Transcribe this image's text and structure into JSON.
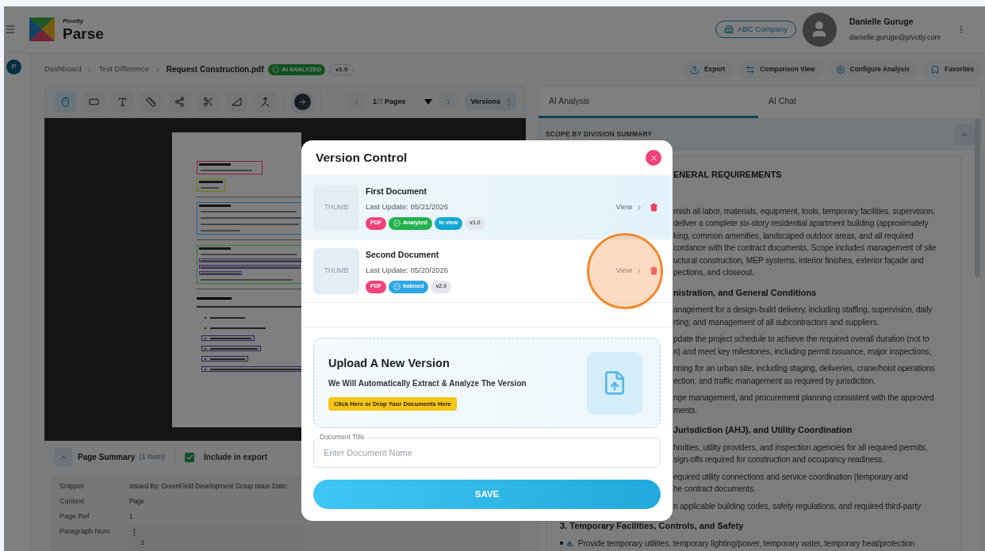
{
  "app": {
    "brand_small": "Pivotly",
    "brand": "Parse"
  },
  "header": {
    "company": "ABC Company",
    "user_name": "Danielle Guruge",
    "user_email": "danielle.guruge@pivotly.com"
  },
  "rail": {
    "avatar_letter": "P"
  },
  "breadcrumb": {
    "items": [
      "Dashboard",
      "Test Difference"
    ],
    "current": "Request Construction.pdf",
    "status": "AI ANALYZED",
    "version": "v1.0"
  },
  "actions": [
    {
      "kind": "export",
      "label": "Export"
    },
    {
      "kind": "compare",
      "label": "Comparison View"
    },
    {
      "kind": "configure",
      "label": "Configure Analysis"
    },
    {
      "kind": "favorite",
      "label": "Favorites"
    }
  ],
  "toolbar": {
    "tools": [
      {
        "kind": "pointer",
        "selected": true
      },
      {
        "kind": "rectangle",
        "selected": false
      },
      {
        "kind": "text",
        "selected": false
      },
      {
        "kind": "ruler",
        "selected": false
      },
      {
        "kind": "connector",
        "selected": false
      },
      {
        "kind": "scissors",
        "selected": false
      },
      {
        "kind": "angle",
        "selected": false
      },
      {
        "kind": "merge",
        "selected": false
      }
    ],
    "pager": {
      "current": "1",
      "total": "/3",
      "label": "Pages"
    },
    "versions": "Versions"
  },
  "document_page": {
    "blocks": [
      {
        "kind": "box",
        "color": "#8b1a4b",
        "lines": [
          {
            "highlighted": false
          }
        ]
      },
      {
        "kind": "box",
        "color": "#77760f",
        "lines": [
          {
            "highlighted": false
          }
        ]
      },
      {
        "kind": "rule"
      },
      {
        "kind": "box",
        "color": "#1f5f99",
        "lines": [
          {
            "highlighted": false
          },
          {
            "highlighted": false
          },
          {
            "highlighted": false
          },
          {
            "highlighted": false
          }
        ]
      },
      {
        "kind": "rule"
      },
      {
        "kind": "box",
        "color": "#2f7a33",
        "lines": [
          {
            "highlighted": false
          },
          {
            "highlighted": true
          },
          {
            "highlighted": true
          },
          {
            "highlighted": true
          },
          {
            "highlighted": false
          }
        ]
      },
      {
        "kind": "rule"
      },
      {
        "kind": "heading"
      },
      {
        "kind": "text"
      },
      {
        "kind": "bullet",
        "highlighted": false
      },
      {
        "kind": "bullet",
        "highlighted": false
      },
      {
        "kind": "bullet",
        "highlighted": true
      },
      {
        "kind": "bullet",
        "highlighted": true
      },
      {
        "kind": "bullet",
        "highlighted": true
      },
      {
        "kind": "bullet",
        "highlighted": true
      }
    ]
  },
  "page_summary": {
    "title": "Page Summary",
    "count": "(1 Item)",
    "include_label": "Include in export",
    "include_checked": true,
    "rows": [
      {
        "label": "Snippet",
        "value": "Issued By: GreenField Development Group Issue Date:"
      },
      {
        "label": "Context",
        "value": "Page"
      },
      {
        "label": "Page Ref",
        "value": "1"
      },
      {
        "label": "Paragraph Num",
        "code": [
          "[",
          "1"
        ]
      }
    ]
  },
  "right_panel": {
    "tabs": [
      {
        "label": "AI Analysis",
        "selected": true
      },
      {
        "label": "AI Chat",
        "selected": false
      }
    ],
    "section_title": "SCOPE BY DIVISION SUMMARY",
    "blocks": [
      {
        "kind": "heading",
        "clipped": true,
        "text": "ENERAL REQUIREMENTS"
      },
      {
        "kind": "paragraph",
        "clipped": true,
        "lines": [
          "rnish all labor, materials, equipment, tools, temporary facilities, supervision,",
          "deliver a complete six-story residential apartment building (approximately",
          "king, common amenities, landscaped outdoor areas, and all required",
          "cordance with the contract documents. Scope includes management of site",
          "uctural construction, MEP systems, interior finishes, exterior façade and",
          "pections, and closeout."
        ]
      },
      {
        "kind": "heading",
        "clipped": true,
        "text": "nistration, and General Conditions"
      },
      {
        "kind": "paragraph",
        "clipped": true,
        "lines": [
          "anagement for a design-build delivery, including staffing, supervision, daily",
          "rting, and management of all subcontractors and suppliers."
        ]
      },
      {
        "kind": "paragraph",
        "clipped": true,
        "lines": [
          "pdate the project schedule to achieve the required overall duration (not to",
          "n) and meet key milestones, including permit issuance, major inspections,"
        ]
      },
      {
        "kind": "paragraph",
        "clipped": true,
        "lines": [
          "nning for an urban site, including staging, deliveries, crane/hoist operations",
          "ection, and traffic management as required by jurisdiction."
        ]
      },
      {
        "kind": "paragraph",
        "clipped": true,
        "lines": [
          "nge management, and procurement planning consistent with the approved",
          "ments."
        ]
      },
      {
        "kind": "heading",
        "clipped": true,
        "text": "Jurisdiction (AHJ), and Utility Coordination"
      },
      {
        "kind": "paragraph",
        "clipped": true,
        "lines": [
          "horities, utility providers, and inspection agencies for all required permits,",
          "sign-offs required for construction and occupancy readiness."
        ]
      },
      {
        "kind": "paragraph",
        "clipped": true,
        "lines": [
          "equired utility connections and service coordination (temporary and",
          "he contract documents."
        ]
      },
      {
        "kind": "paragraph",
        "clipped": true,
        "lines": [
          "n applicable building codes, safety regulations, and required third-party"
        ]
      },
      {
        "kind": "heading",
        "clipped": false,
        "text": "3. Temporary Facilities, Controls, and Safety"
      },
      {
        "kind": "item",
        "clipped": false,
        "marker": "a.",
        "text": "Provide temporary utilities, temporary lighting/power, temporary water, temporary heat/protection"
      }
    ]
  },
  "modal": {
    "title": "Version Control",
    "documents": [
      {
        "thumb": "THUMB",
        "name": "First Document",
        "updated": "Last Update: 05/21/2026",
        "selected": true,
        "view": "View",
        "tags": [
          {
            "kind": "plain",
            "text": "PDF",
            "color": "#f0437a"
          },
          {
            "kind": "status",
            "text": "Analyzed",
            "color": "#22b14c"
          },
          {
            "kind": "plain",
            "text": "In view",
            "color": "#14a8d4"
          },
          {
            "kind": "plain",
            "text": "v1.0",
            "color": "#e4e7ee"
          }
        ]
      },
      {
        "thumb": "THUMB",
        "name": "Second Document",
        "updated": "Last Update: 05/20/2026",
        "selected": false,
        "view": "View",
        "tags": [
          {
            "kind": "plain",
            "text": "PDF",
            "color": "#f0437a"
          },
          {
            "kind": "status",
            "text": "Indexed",
            "color": "#2ea6e6"
          },
          {
            "kind": "plain",
            "text": "v2.0",
            "color": "#e4e7ee"
          }
        ]
      }
    ],
    "upload": {
      "title": "Upload A New Version",
      "subtitle": "We Will Automatically Extract & Analyze The Version",
      "button": "Click Here or Drop Your Documents Here"
    },
    "title_field": {
      "label": "Document Title",
      "placeholder": "Enter Document Name"
    },
    "save": "SAVE"
  }
}
